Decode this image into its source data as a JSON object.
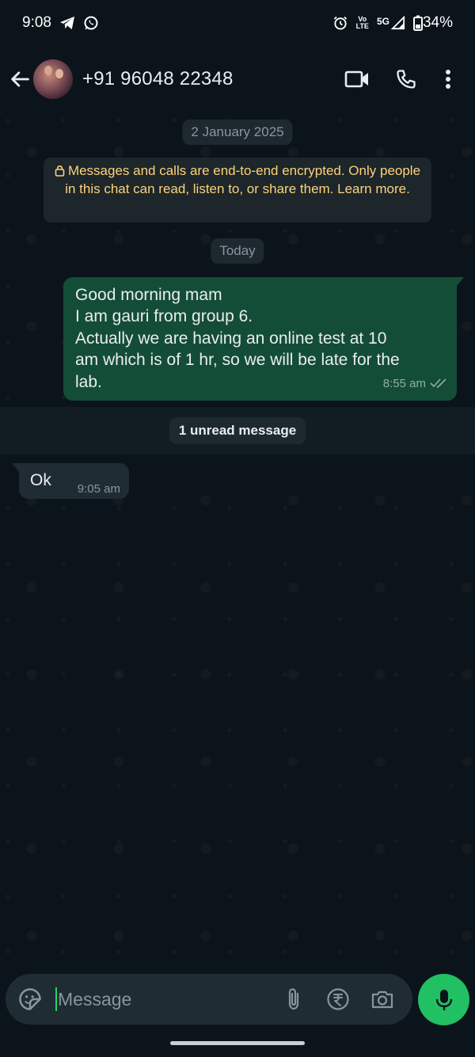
{
  "status_bar": {
    "time": "9:08",
    "volte_top": "Vo",
    "volte_bottom": "LTE",
    "network": "5G",
    "battery": "34%",
    "icons": [
      "telegram-icon",
      "whatsapp-icon",
      "alarm-icon",
      "signal-icon",
      "battery-icon"
    ]
  },
  "header": {
    "contact_name": "+91 96048 22348",
    "icons": [
      "back-arrow-icon",
      "avatar",
      "video-call-icon",
      "voice-call-icon",
      "more-options-icon"
    ]
  },
  "chat": {
    "date_chip": "2 January 2025",
    "encryption_notice": "Messages and calls are end-to-end encrypted. Only people in this chat can read, listen to, or share them. Learn more.",
    "today_chip": "Today",
    "outgoing": {
      "lines": [
        "Good morning mam",
        "I am gauri from group 6.",
        "Actually we are having an online test at 10",
        "am which is of 1 hr, so we will be late for the",
        "lab."
      ],
      "time": "8:55 am",
      "status": "read"
    },
    "unread_label": "1 unread message",
    "incoming": {
      "text": "Ok",
      "time": "9:05 am"
    }
  },
  "input": {
    "placeholder": "Message",
    "icons": [
      "emoji-sticker-icon",
      "attach-icon",
      "rupee-payment-icon",
      "camera-icon",
      "mic-icon"
    ]
  },
  "colors": {
    "background": "#0b141a",
    "outgoing_bubble": "#144d37",
    "incoming_bubble": "#202c33",
    "encryption_text": "#ffd279",
    "accent_green": "#21c063"
  }
}
